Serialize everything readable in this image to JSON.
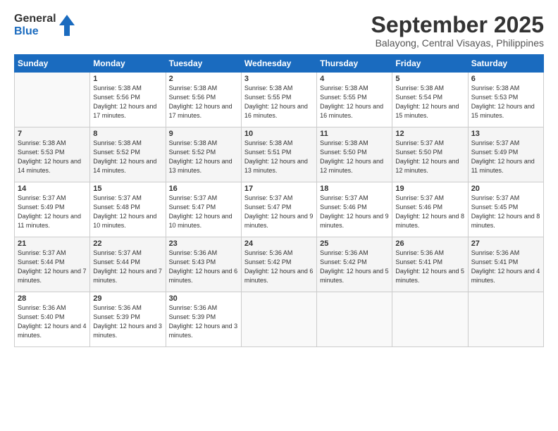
{
  "header": {
    "logo_line1": "General",
    "logo_line2": "Blue",
    "month": "September 2025",
    "location": "Balayong, Central Visayas, Philippines"
  },
  "weekdays": [
    "Sunday",
    "Monday",
    "Tuesday",
    "Wednesday",
    "Thursday",
    "Friday",
    "Saturday"
  ],
  "weeks": [
    [
      {
        "day": "",
        "info": ""
      },
      {
        "day": "1",
        "info": "Sunrise: 5:38 AM\nSunset: 5:56 PM\nDaylight: 12 hours\nand 17 minutes."
      },
      {
        "day": "2",
        "info": "Sunrise: 5:38 AM\nSunset: 5:56 PM\nDaylight: 12 hours\nand 17 minutes."
      },
      {
        "day": "3",
        "info": "Sunrise: 5:38 AM\nSunset: 5:55 PM\nDaylight: 12 hours\nand 16 minutes."
      },
      {
        "day": "4",
        "info": "Sunrise: 5:38 AM\nSunset: 5:55 PM\nDaylight: 12 hours\nand 16 minutes."
      },
      {
        "day": "5",
        "info": "Sunrise: 5:38 AM\nSunset: 5:54 PM\nDaylight: 12 hours\nand 15 minutes."
      },
      {
        "day": "6",
        "info": "Sunrise: 5:38 AM\nSunset: 5:53 PM\nDaylight: 12 hours\nand 15 minutes."
      }
    ],
    [
      {
        "day": "7",
        "info": "Sunrise: 5:38 AM\nSunset: 5:53 PM\nDaylight: 12 hours\nand 14 minutes."
      },
      {
        "day": "8",
        "info": "Sunrise: 5:38 AM\nSunset: 5:52 PM\nDaylight: 12 hours\nand 14 minutes."
      },
      {
        "day": "9",
        "info": "Sunrise: 5:38 AM\nSunset: 5:52 PM\nDaylight: 12 hours\nand 13 minutes."
      },
      {
        "day": "10",
        "info": "Sunrise: 5:38 AM\nSunset: 5:51 PM\nDaylight: 12 hours\nand 13 minutes."
      },
      {
        "day": "11",
        "info": "Sunrise: 5:38 AM\nSunset: 5:50 PM\nDaylight: 12 hours\nand 12 minutes."
      },
      {
        "day": "12",
        "info": "Sunrise: 5:37 AM\nSunset: 5:50 PM\nDaylight: 12 hours\nand 12 minutes."
      },
      {
        "day": "13",
        "info": "Sunrise: 5:37 AM\nSunset: 5:49 PM\nDaylight: 12 hours\nand 11 minutes."
      }
    ],
    [
      {
        "day": "14",
        "info": "Sunrise: 5:37 AM\nSunset: 5:49 PM\nDaylight: 12 hours\nand 11 minutes."
      },
      {
        "day": "15",
        "info": "Sunrise: 5:37 AM\nSunset: 5:48 PM\nDaylight: 12 hours\nand 10 minutes."
      },
      {
        "day": "16",
        "info": "Sunrise: 5:37 AM\nSunset: 5:47 PM\nDaylight: 12 hours\nand 10 minutes."
      },
      {
        "day": "17",
        "info": "Sunrise: 5:37 AM\nSunset: 5:47 PM\nDaylight: 12 hours\nand 9 minutes."
      },
      {
        "day": "18",
        "info": "Sunrise: 5:37 AM\nSunset: 5:46 PM\nDaylight: 12 hours\nand 9 minutes."
      },
      {
        "day": "19",
        "info": "Sunrise: 5:37 AM\nSunset: 5:46 PM\nDaylight: 12 hours\nand 8 minutes."
      },
      {
        "day": "20",
        "info": "Sunrise: 5:37 AM\nSunset: 5:45 PM\nDaylight: 12 hours\nand 8 minutes."
      }
    ],
    [
      {
        "day": "21",
        "info": "Sunrise: 5:37 AM\nSunset: 5:44 PM\nDaylight: 12 hours\nand 7 minutes."
      },
      {
        "day": "22",
        "info": "Sunrise: 5:37 AM\nSunset: 5:44 PM\nDaylight: 12 hours\nand 7 minutes."
      },
      {
        "day": "23",
        "info": "Sunrise: 5:36 AM\nSunset: 5:43 PM\nDaylight: 12 hours\nand 6 minutes."
      },
      {
        "day": "24",
        "info": "Sunrise: 5:36 AM\nSunset: 5:42 PM\nDaylight: 12 hours\nand 6 minutes."
      },
      {
        "day": "25",
        "info": "Sunrise: 5:36 AM\nSunset: 5:42 PM\nDaylight: 12 hours\nand 5 minutes."
      },
      {
        "day": "26",
        "info": "Sunrise: 5:36 AM\nSunset: 5:41 PM\nDaylight: 12 hours\nand 5 minutes."
      },
      {
        "day": "27",
        "info": "Sunrise: 5:36 AM\nSunset: 5:41 PM\nDaylight: 12 hours\nand 4 minutes."
      }
    ],
    [
      {
        "day": "28",
        "info": "Sunrise: 5:36 AM\nSunset: 5:40 PM\nDaylight: 12 hours\nand 4 minutes."
      },
      {
        "day": "29",
        "info": "Sunrise: 5:36 AM\nSunset: 5:39 PM\nDaylight: 12 hours\nand 3 minutes."
      },
      {
        "day": "30",
        "info": "Sunrise: 5:36 AM\nSunset: 5:39 PM\nDaylight: 12 hours\nand 3 minutes."
      },
      {
        "day": "",
        "info": ""
      },
      {
        "day": "",
        "info": ""
      },
      {
        "day": "",
        "info": ""
      },
      {
        "day": "",
        "info": ""
      }
    ]
  ]
}
